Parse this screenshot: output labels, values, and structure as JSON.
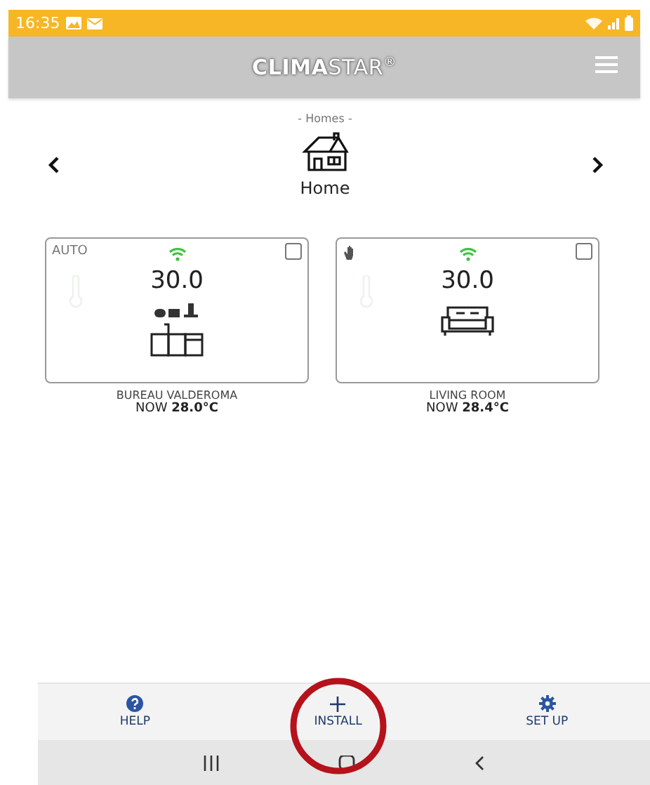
{
  "status_bar": {
    "time": "16:35"
  },
  "header": {
    "brand_bold": "CLIMA",
    "brand_light": "STAR",
    "brand_mark": "®"
  },
  "homes": {
    "caption": "- Homes -",
    "name": "Home"
  },
  "rooms": [
    {
      "mode": {
        "kind": "text",
        "label": "AUTO"
      },
      "setpoint": "30.0",
      "kind": "kitchen",
      "checked": false,
      "name": "BUREAU VALDEROMA",
      "now": "NOW **28.0°C**"
    },
    {
      "mode": {
        "kind": "manual"
      },
      "setpoint": "30.0",
      "kind": "sofa",
      "checked": false,
      "name": "LIVING ROOM",
      "now": "NOW **28.4°C**"
    }
  ],
  "bottom_nav": [
    {
      "kind": "help",
      "label": "HELP"
    },
    {
      "kind": "install",
      "label": "INSTALL",
      "circled": true
    },
    {
      "kind": "setup",
      "label": "SET UP"
    }
  ]
}
